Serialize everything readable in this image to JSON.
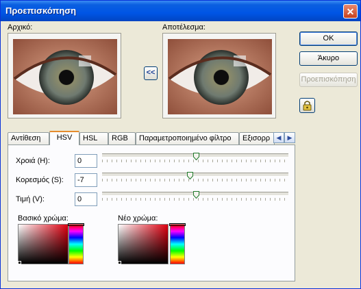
{
  "window": {
    "title": "Προεπισκόπηση"
  },
  "close_label": "✕",
  "labels": {
    "original": "Αρχικό:",
    "result": "Αποτέλεσμα:"
  },
  "copy_button": "<<",
  "buttons": {
    "ok": "OK",
    "cancel": "Άκυρο",
    "preview": "Προεπισκόπηση"
  },
  "tabs": [
    {
      "label": "Αντίθεση",
      "active": false
    },
    {
      "label": "HSV",
      "active": true
    },
    {
      "label": "HSL",
      "active": false
    },
    {
      "label": "RGB",
      "active": false
    },
    {
      "label": "Παραμετροποιημένο φίλτρο",
      "active": false
    },
    {
      "label": "Εξισορρ",
      "active": false
    }
  ],
  "tab_scroll": {
    "left": "◀",
    "right": "▶"
  },
  "hsv": {
    "hue": {
      "label": "Χροιά (H):",
      "value": "0"
    },
    "saturation": {
      "label": "Κορεσμός (S):",
      "value": "-7"
    },
    "value": {
      "label": "Τιμή (V):",
      "value": "0"
    }
  },
  "colors": {
    "basic_label": "Βασικό χρώμα:",
    "new_label": "Νέο χρώμα:"
  },
  "accent": {
    "title_bar": "#0055e5",
    "tab_highlight": "#e68b2c"
  }
}
